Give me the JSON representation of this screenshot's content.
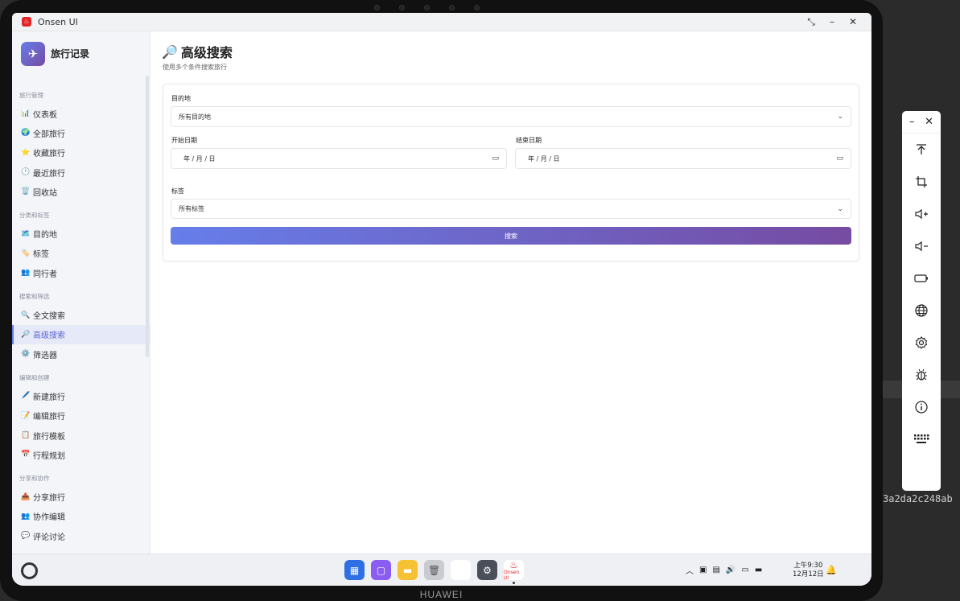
{
  "window": {
    "app_title": "Onsen UI",
    "logo_text": "Onsen UI",
    "controls": [
      "⤡",
      "–",
      "✕"
    ]
  },
  "sidebar": {
    "title": "旅行记录",
    "sections": [
      {
        "header": "旅行管理",
        "items": [
          {
            "icon": "📊",
            "label": "仪表板"
          },
          {
            "icon": "🌍",
            "label": "全部旅行"
          },
          {
            "icon": "⭐",
            "label": "收藏旅行"
          },
          {
            "icon": "🕐",
            "label": "最近旅行"
          },
          {
            "icon": "🗑️",
            "label": "回收站"
          }
        ]
      },
      {
        "header": "分类和标签",
        "items": [
          {
            "icon": "🗺️",
            "label": "目的地"
          },
          {
            "icon": "🏷️",
            "label": "标签"
          },
          {
            "icon": "👥",
            "label": "同行者"
          }
        ]
      },
      {
        "header": "搜索和筛选",
        "items": [
          {
            "icon": "🔍",
            "label": "全文搜索"
          },
          {
            "icon": "🔎",
            "label": "高级搜索",
            "active": true
          },
          {
            "icon": "⚙️",
            "label": "筛选器"
          }
        ]
      },
      {
        "header": "编辑和创建",
        "items": [
          {
            "icon": "🖊️",
            "label": "新建旅行"
          },
          {
            "icon": "📝",
            "label": "编辑旅行"
          },
          {
            "icon": "📋",
            "label": "旅行模板"
          },
          {
            "icon": "📅",
            "label": "行程规划"
          }
        ]
      },
      {
        "header": "分享和协作",
        "items": [
          {
            "icon": "📤",
            "label": "分享旅行"
          },
          {
            "icon": "👥",
            "label": "协作编辑"
          },
          {
            "icon": "💬",
            "label": "评论讨论"
          }
        ]
      }
    ]
  },
  "main": {
    "title_icon": "🔎",
    "title": "高级搜索",
    "subtitle": "使用多个条件搜索旅行",
    "destination_label": "目的地",
    "destination_value": "所有目的地",
    "start_date_label": "开始日期",
    "start_date_value": "年 / 月 / 日",
    "end_date_label": "结束日期",
    "end_date_value": "年 / 月 / 日",
    "tags_label": "标签",
    "tags_value": "所有标签",
    "search_button": "搜索"
  },
  "taskbar": {
    "clock_time": "上午9:30",
    "clock_date": "12月12日",
    "dock_badge": "Onsen UI"
  },
  "device": {
    "brand": "HUAWEI"
  },
  "side_label": "3a2da2c248ab",
  "colors": {
    "accent_start": "#667eea",
    "accent_end": "#764ba2"
  }
}
